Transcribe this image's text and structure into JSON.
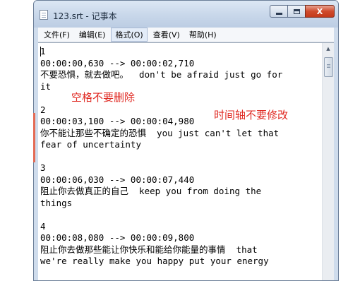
{
  "window": {
    "title": "123.srt - 记事本",
    "close_glyph": "X",
    "icons": {
      "app": "notepad-icon",
      "minimize": "minimize-icon",
      "maximize": "maximize-icon",
      "close": "close-icon"
    }
  },
  "menu": {
    "items": [
      {
        "label": "文件(F)"
      },
      {
        "label": "编辑(E)"
      },
      {
        "label": "格式(O)"
      },
      {
        "label": "查看(V)"
      },
      {
        "label": "帮助(H)"
      }
    ]
  },
  "editor": {
    "lines": [
      "1",
      "00:00:00,630 --> 00:00:02,710",
      "不要恐惧，就去做吧。  don't be afraid just go for",
      "it",
      "",
      "2",
      "00:00:03,100 --> 00:00:04,980",
      "你不能让那些不确定的恐惧  you just can't let that",
      "fear of uncertainty",
      "",
      "3",
      "00:00:06,030 --> 00:00:07,440",
      "阻止你去做真正的自己  keep you from doing the",
      "things",
      "",
      "4",
      "00:00:08,080 --> 00:00:09,800",
      "阻止你去做那些能让你快乐和能给你能量的事情  that",
      "we're really make you happy put your energy"
    ]
  },
  "annotations": {
    "space_note": "空格不要删除",
    "timeline_note": "时间轴不要修改"
  },
  "scrollbar": {
    "up_glyph": "▲",
    "icon": "scroll-up-arrow-icon"
  }
}
